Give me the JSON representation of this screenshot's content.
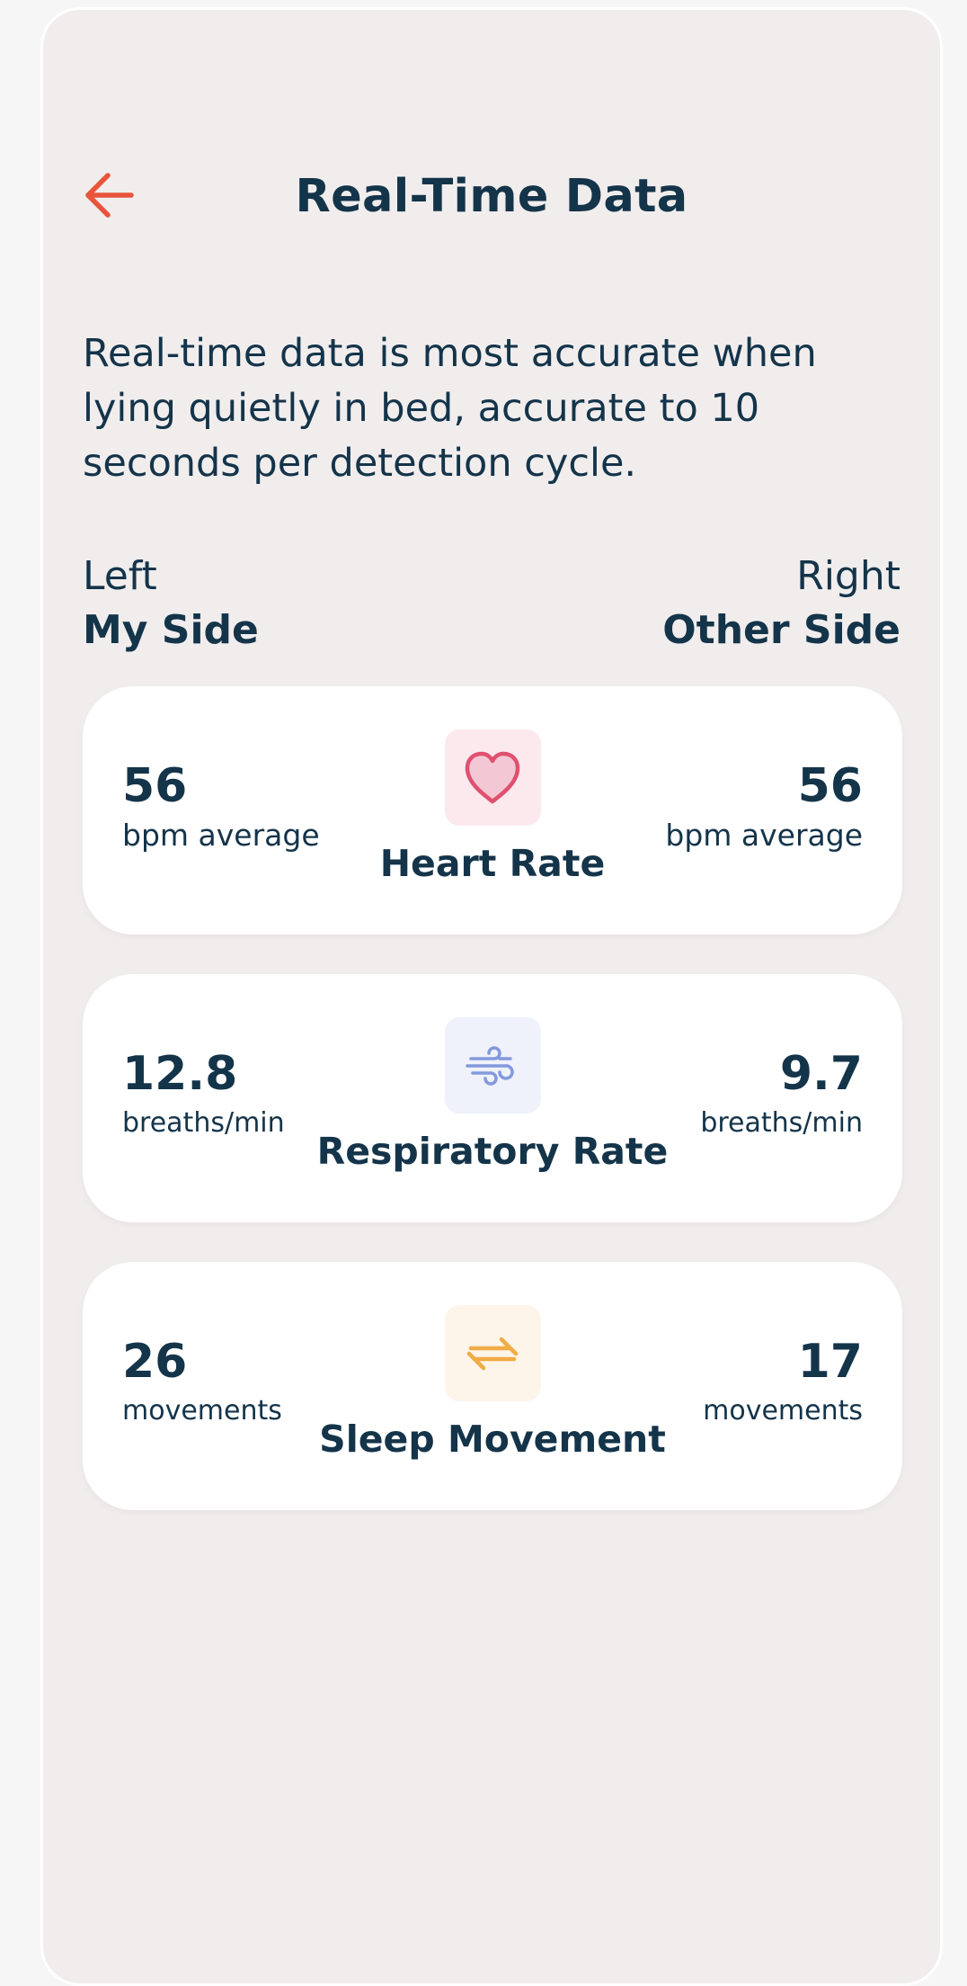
{
  "header": {
    "title": "Real-Time Data",
    "back_icon": "arrow-left-icon"
  },
  "description": "Real-time data is most accurate when lying quietly in bed, accurate to 10 seconds per detection cycle.",
  "sides": {
    "left": {
      "position": "Left",
      "name": "My Side"
    },
    "right": {
      "position": "Right",
      "name": "Other Side"
    }
  },
  "metrics": [
    {
      "name": "Heart Rate",
      "icon": "heart-icon",
      "left_value": "56",
      "left_unit": "bpm average",
      "right_value": "56",
      "right_unit": "bpm average"
    },
    {
      "name": "Respiratory Rate",
      "icon": "wind-icon",
      "left_value": "12.8",
      "left_unit": "breaths/min",
      "right_value": "9.7",
      "right_unit": "breaths/min"
    },
    {
      "name": "Sleep Movement",
      "icon": "swap-arrows-icon",
      "left_value": "26",
      "left_unit": "movements",
      "right_value": "17",
      "right_unit": "movements"
    }
  ],
  "colors": {
    "accent": "#e8553a",
    "text": "#14344a",
    "background": "#f1eded",
    "card": "#ffffff",
    "heart_tile": "#fbe9ee",
    "heart_icon": "#e0506f",
    "wind_tile": "#eff2fb",
    "wind_icon": "#8399dd",
    "movement_tile": "#fdf5ea",
    "movement_icon": "#f1ac45"
  }
}
